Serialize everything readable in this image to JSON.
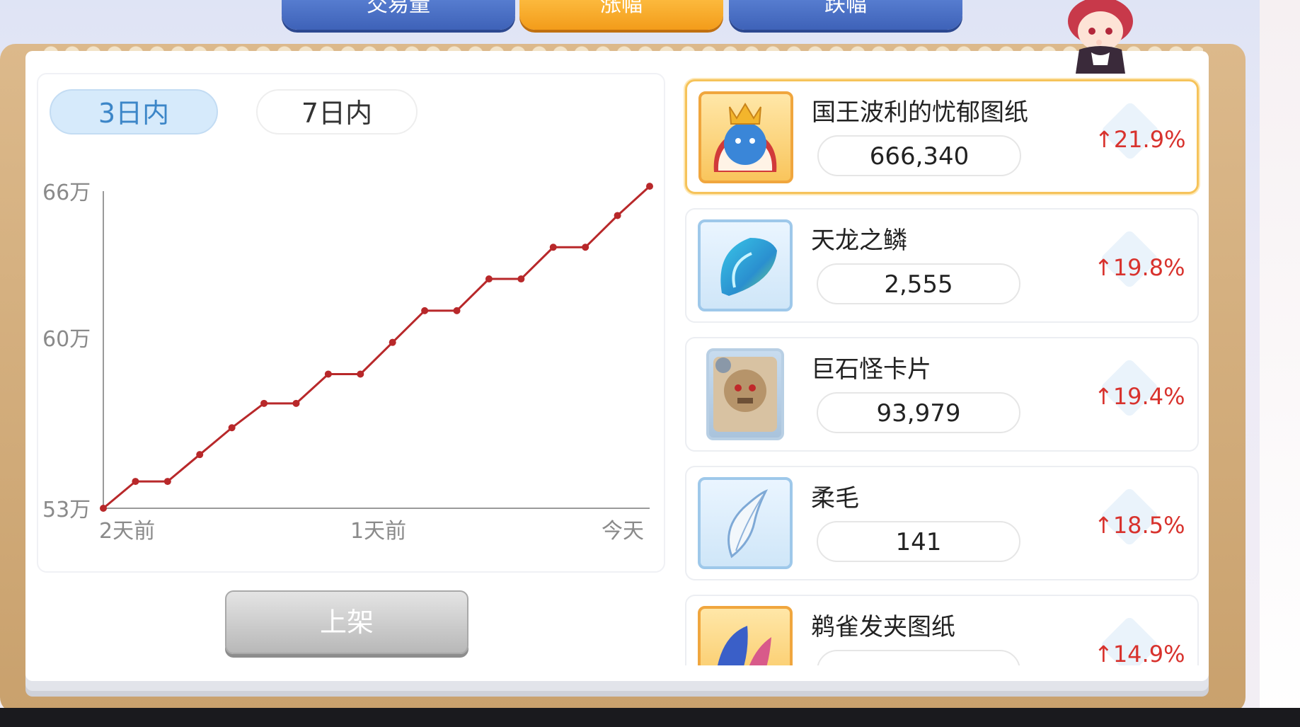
{
  "tabs": [
    {
      "label": "交易量",
      "active": false
    },
    {
      "label": "涨幅",
      "active": true
    },
    {
      "label": "跌幅",
      "active": false
    }
  ],
  "period_filters": [
    {
      "label": "3日内",
      "active": true
    },
    {
      "label": "7日内",
      "active": false
    }
  ],
  "sell_button": "上架",
  "items": [
    {
      "name": "国王波利的忧郁图纸",
      "price": "666,340",
      "change": "↑21.9%",
      "icon": "king-poring-blueprint-icon",
      "selected": true
    },
    {
      "name": "天龙之鳞",
      "price": "2,555",
      "change": "↑19.8%",
      "icon": "dragon-scale-icon",
      "selected": false
    },
    {
      "name": "巨石怪卡片",
      "price": "93,979",
      "change": "↑19.4%",
      "icon": "golem-card-icon",
      "selected": false
    },
    {
      "name": "柔毛",
      "price": "141",
      "change": "↑18.5%",
      "icon": "soft-feather-icon",
      "selected": false
    },
    {
      "name": "鹈雀发夹图纸",
      "price": "",
      "change": "↑14.9%",
      "icon": "bird-hairpin-blueprint-icon",
      "selected": false
    }
  ],
  "colors": {
    "accent_up": "#d8322d",
    "line": "#b8282a",
    "active_tab": "#f39c1a"
  },
  "chart_data": {
    "type": "line",
    "title": "",
    "xlabel": "",
    "ylabel": "",
    "x_tick_labels": [
      "2天前",
      "1天前",
      "今天"
    ],
    "y_tick_labels": [
      "66万",
      "60万",
      "53万"
    ],
    "ylim": [
      53,
      66
    ],
    "y_unit": "万",
    "grid": false,
    "series": [
      {
        "values": [
          53.0,
          54.1,
          54.1,
          55.2,
          56.3,
          57.3,
          57.3,
          58.5,
          58.5,
          59.8,
          61.1,
          61.1,
          62.4,
          62.4,
          63.7,
          63.7,
          65.0,
          66.2
        ]
      }
    ]
  }
}
